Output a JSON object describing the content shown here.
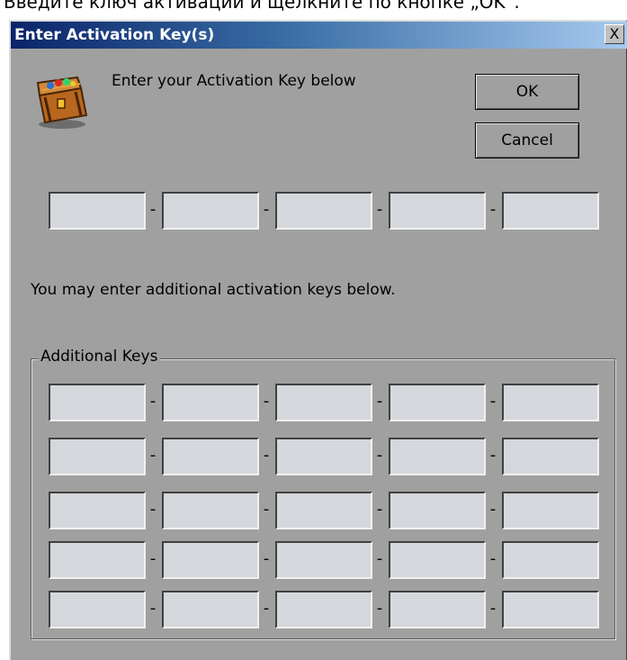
{
  "caption_above": "Введите ключ активации и щелкните по кнопке „OK“.",
  "window": {
    "title": "Enter Activation Key(s)",
    "close_glyph": "X"
  },
  "icon": "treasure-chest-icon",
  "instruction": "Enter your Activation Key below",
  "buttons": {
    "ok": "OK",
    "cancel": "Cancel"
  },
  "primary_key": {
    "segments": [
      "",
      "",
      "",
      "",
      ""
    ],
    "separator": "-"
  },
  "additional_text": "You may enter additional activation keys below.",
  "additional_keys": {
    "legend": "Additional Keys",
    "rows": [
      [
        "",
        "",
        "",
        "",
        ""
      ],
      [
        "",
        "",
        "",
        "",
        ""
      ],
      [
        "",
        "",
        "",
        "",
        ""
      ],
      [
        "",
        "",
        "",
        "",
        ""
      ],
      [
        "",
        "",
        "",
        "",
        ""
      ]
    ]
  },
  "colors": {
    "title_start": "#0a246a",
    "title_end": "#a6caf0",
    "dialog_bg": "#a0a0a0",
    "field_bg": "#d4d8dc"
  }
}
